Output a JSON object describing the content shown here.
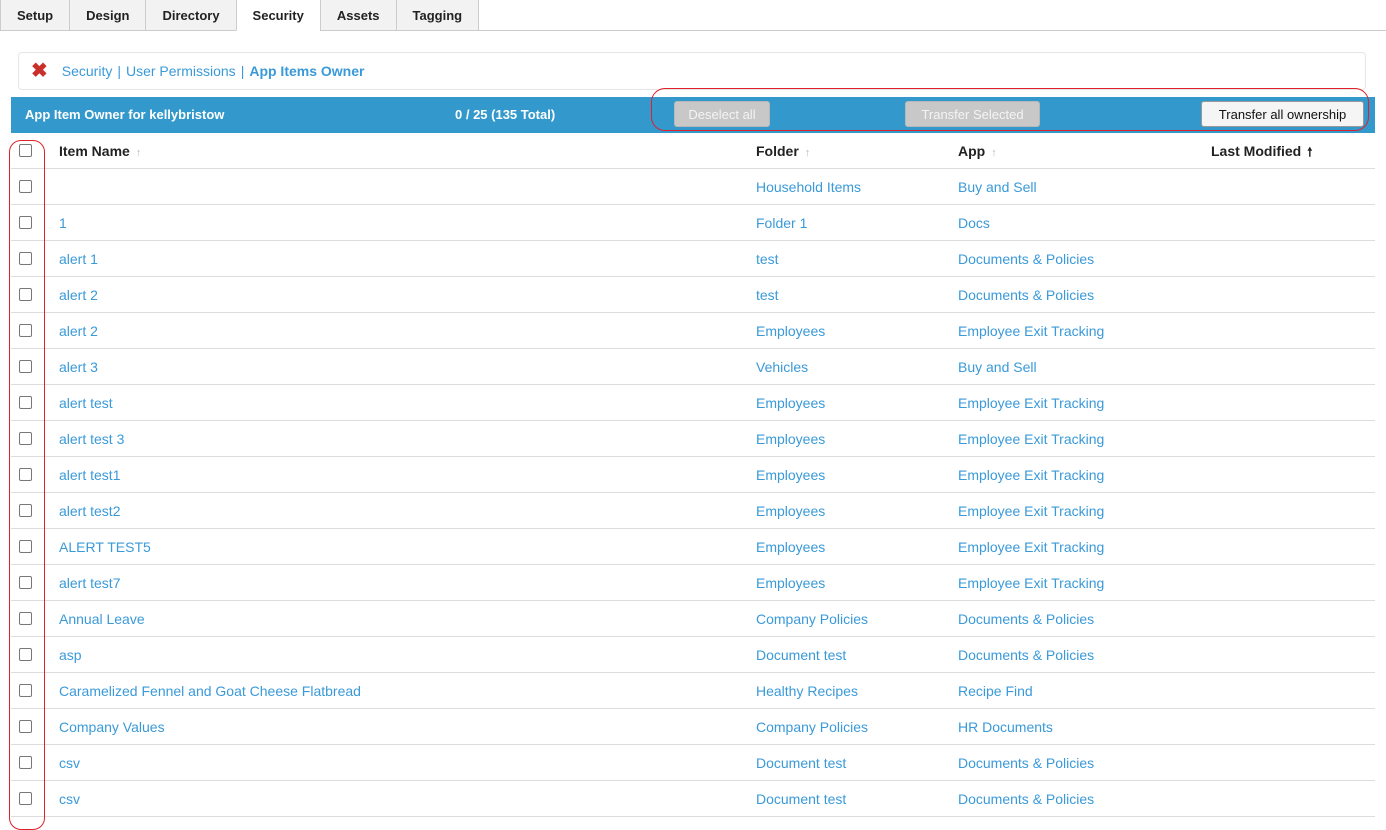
{
  "tabs": [
    {
      "label": "Setup",
      "active": false
    },
    {
      "label": "Design",
      "active": false
    },
    {
      "label": "Directory",
      "active": false
    },
    {
      "label": "Security",
      "active": true
    },
    {
      "label": "Assets",
      "active": false
    },
    {
      "label": "Tagging",
      "active": false
    }
  ],
  "breadcrumb": {
    "items": [
      "Security",
      "User Permissions"
    ],
    "separator": "|",
    "current": "App Items Owner"
  },
  "panel": {
    "title": "App Item Owner for kellybristow",
    "count": "0 / 25 (135 Total)",
    "deselect_label": "Deselect all",
    "transfer_selected_label": "Transfer Selected",
    "transfer_all_label": "Transfer all ownership"
  },
  "columns": {
    "name": "Item Name",
    "folder": "Folder",
    "app": "App",
    "modified": "Last Modified"
  },
  "sort_icons": {
    "inactive": "↑",
    "active": "🠕"
  },
  "rows": [
    {
      "name": "",
      "folder": "Household Items",
      "app": "Buy and Sell"
    },
    {
      "name": "1",
      "folder": "Folder 1",
      "app": "Docs"
    },
    {
      "name": "alert 1",
      "folder": "test",
      "app": "Documents & Policies"
    },
    {
      "name": "alert 2",
      "folder": "test",
      "app": "Documents & Policies"
    },
    {
      "name": "alert 2",
      "folder": "Employees",
      "app": "Employee Exit Tracking"
    },
    {
      "name": "alert 3",
      "folder": "Vehicles",
      "app": "Buy and Sell"
    },
    {
      "name": "alert test",
      "folder": "Employees",
      "app": "Employee Exit Tracking"
    },
    {
      "name": "alert test 3",
      "folder": "Employees",
      "app": "Employee Exit Tracking"
    },
    {
      "name": "alert test1",
      "folder": "Employees",
      "app": "Employee Exit Tracking"
    },
    {
      "name": "alert test2",
      "folder": "Employees",
      "app": "Employee Exit Tracking"
    },
    {
      "name": "ALERT TEST5",
      "folder": "Employees",
      "app": "Employee Exit Tracking"
    },
    {
      "name": "alert test7",
      "folder": "Employees",
      "app": "Employee Exit Tracking"
    },
    {
      "name": "Annual Leave",
      "folder": "Company Policies",
      "app": "Documents & Policies"
    },
    {
      "name": "asp",
      "folder": "Document test",
      "app": "Documents & Policies"
    },
    {
      "name": "Caramelized Fennel and Goat Cheese Flatbread",
      "folder": "Healthy Recipes",
      "app": "Recipe Find"
    },
    {
      "name": "Company Values",
      "folder": "Company Policies",
      "app": "HR Documents"
    },
    {
      "name": "csv",
      "folder": "Document test",
      "app": "Documents & Policies"
    },
    {
      "name": "csv",
      "folder": "Document test",
      "app": "Documents & Policies"
    }
  ],
  "colors": {
    "accent": "#3399cc",
    "link": "#3a9ad9",
    "close": "#c9302c",
    "annotation": "#e0202a"
  }
}
